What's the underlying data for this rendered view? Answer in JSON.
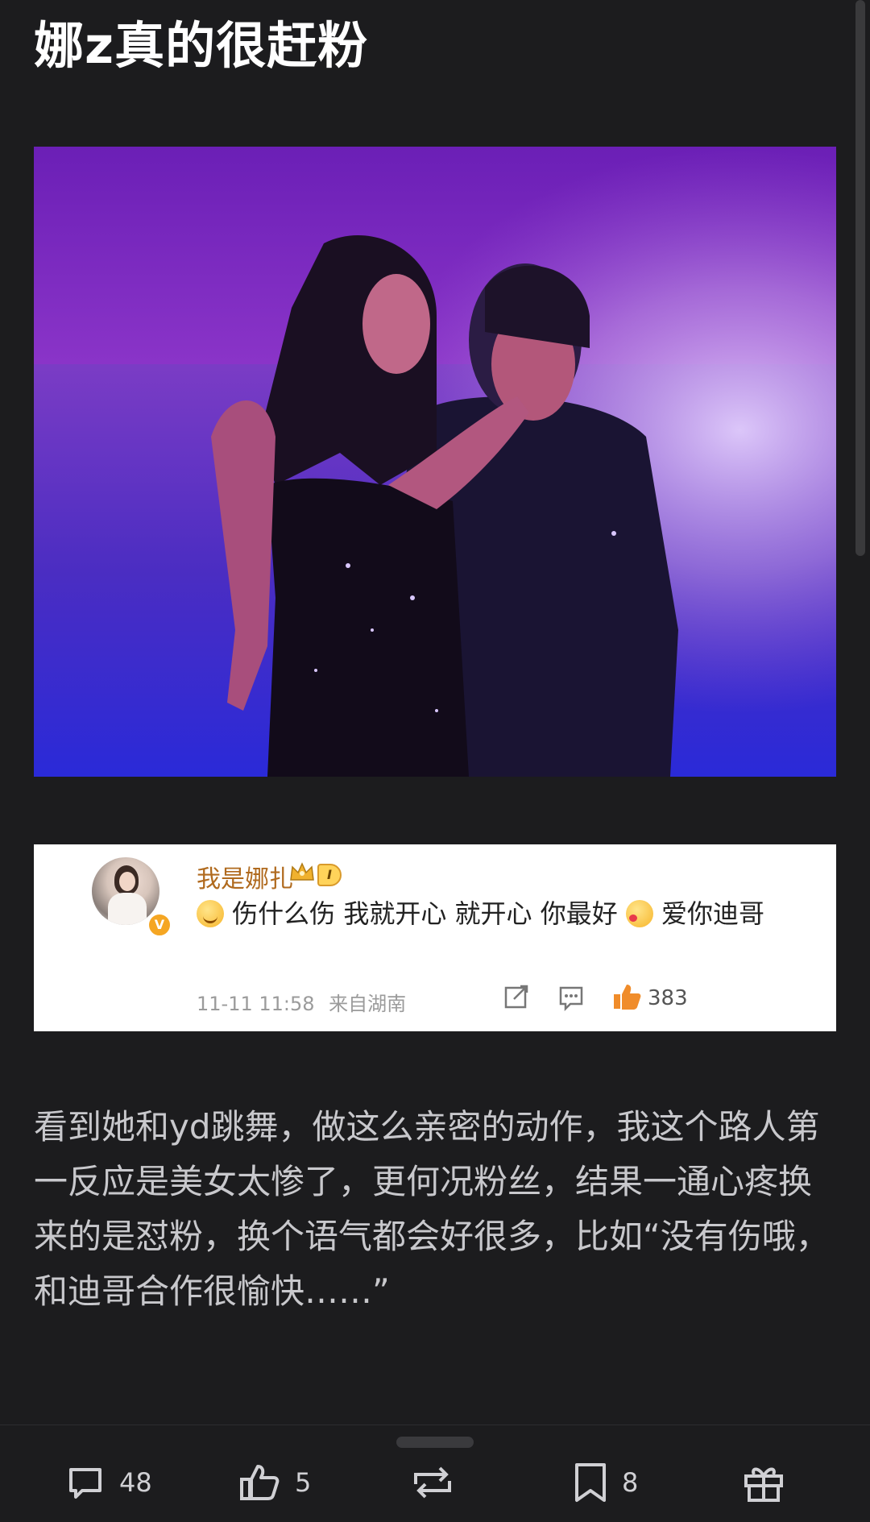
{
  "post": {
    "title": "娜z真的很赶粉",
    "body": "看到她和yd跳舞，做这么亲密的动作，我这个路人第一反应是美女太惨了，更何况粉丝，结果一通心疼换来的是怼粉，换个语气都会好很多，比如“没有伤哦，和迪哥合作很愉快……”"
  },
  "comment": {
    "username": "我是娜扎",
    "verified_badge": "V",
    "level_badge": "I",
    "text_part1": "伤什么伤 我就开心 就开心 你最好",
    "text_part2": "爱你迪哥",
    "time": "11-11 11:58",
    "location": "来自湖南",
    "likes": "383",
    "icons": {
      "emoji_1": "smiling-emoji-icon",
      "emoji_2": "kiss-emoji-icon",
      "share": "share-icon",
      "reply": "comment-icon",
      "like": "thumbs-up-icon"
    }
  },
  "bottom_bar": {
    "comments": "48",
    "likes": "5",
    "repost": "",
    "favorites": "8",
    "gift": ""
  },
  "colors": {
    "background": "#1c1c1e",
    "title": "#ffffff",
    "body_text": "#c8c8cc",
    "username": "#b06a1e",
    "like_icon": "#f08c2a"
  }
}
